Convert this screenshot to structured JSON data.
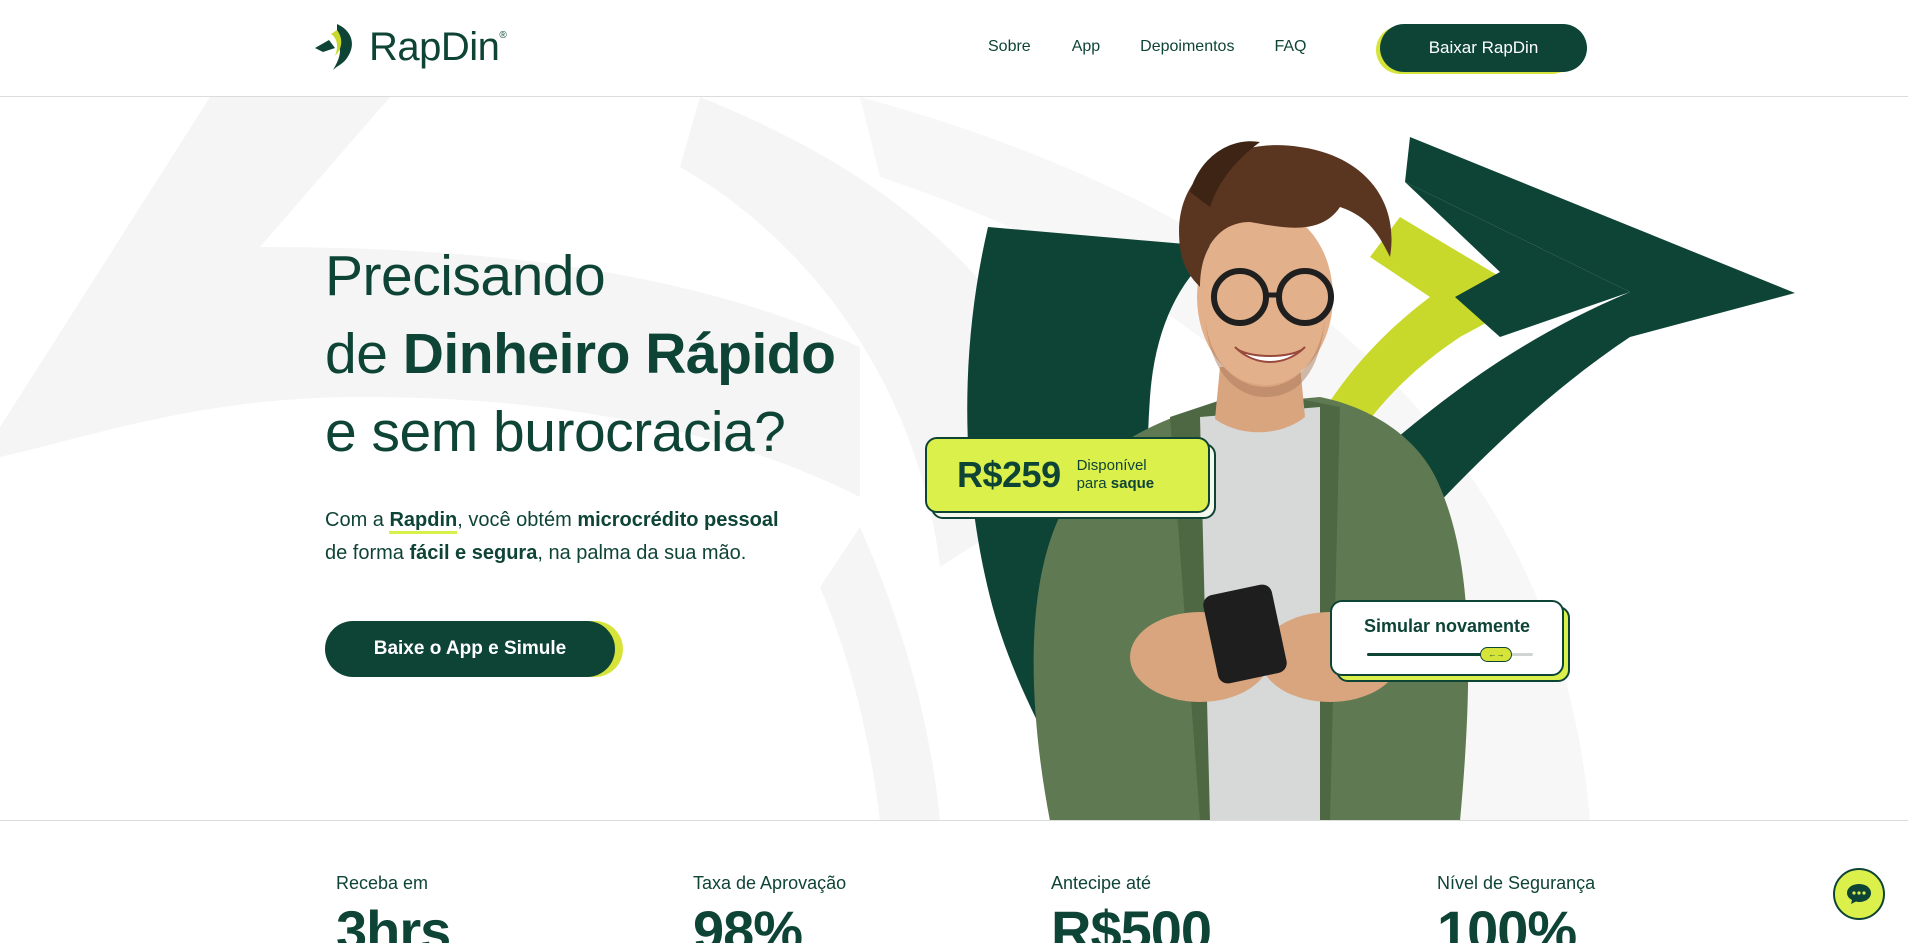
{
  "brand": {
    "name": "RapDin",
    "registered": "®",
    "colors": {
      "primary": "#0e4436",
      "accent": "#d8f04a",
      "background": "#ffffff"
    }
  },
  "nav": {
    "items": [
      "Sobre",
      "App",
      "Depoimentos",
      "FAQ"
    ],
    "cta_label": "Baixar RapDin"
  },
  "hero": {
    "line1": "Precisando",
    "line2_prefix": "de ",
    "line2_strong": "Dinheiro Rápido",
    "line3": "e sem burocracia?",
    "sub": {
      "t1": "Com a ",
      "brand": "Rapdin",
      "t2": ", você obtém ",
      "b1": "microcrédito pessoal",
      "t3": "de forma ",
      "b2": "fácil e segura",
      "t4": ", na palma da sua mão."
    },
    "cta_label": "Baixe o App e Simule"
  },
  "amount_card": {
    "value": "R$259",
    "label_line1": "Disponível",
    "label_prefix": "para ",
    "label_strong": "saque"
  },
  "simulate_card": {
    "title": "Simular novamente",
    "slider_fraction": 0.78,
    "knob_icon": "arrows-icon"
  },
  "stats": [
    {
      "label": "Receba em",
      "value": "3hrs"
    },
    {
      "label": "Taxa de Aprovação",
      "value": "98%"
    },
    {
      "label": "Antecipe até",
      "value": "R$500"
    },
    {
      "label": "Nível de Segurança",
      "value": "100%"
    }
  ],
  "chat": {
    "icon": "chat-icon"
  }
}
